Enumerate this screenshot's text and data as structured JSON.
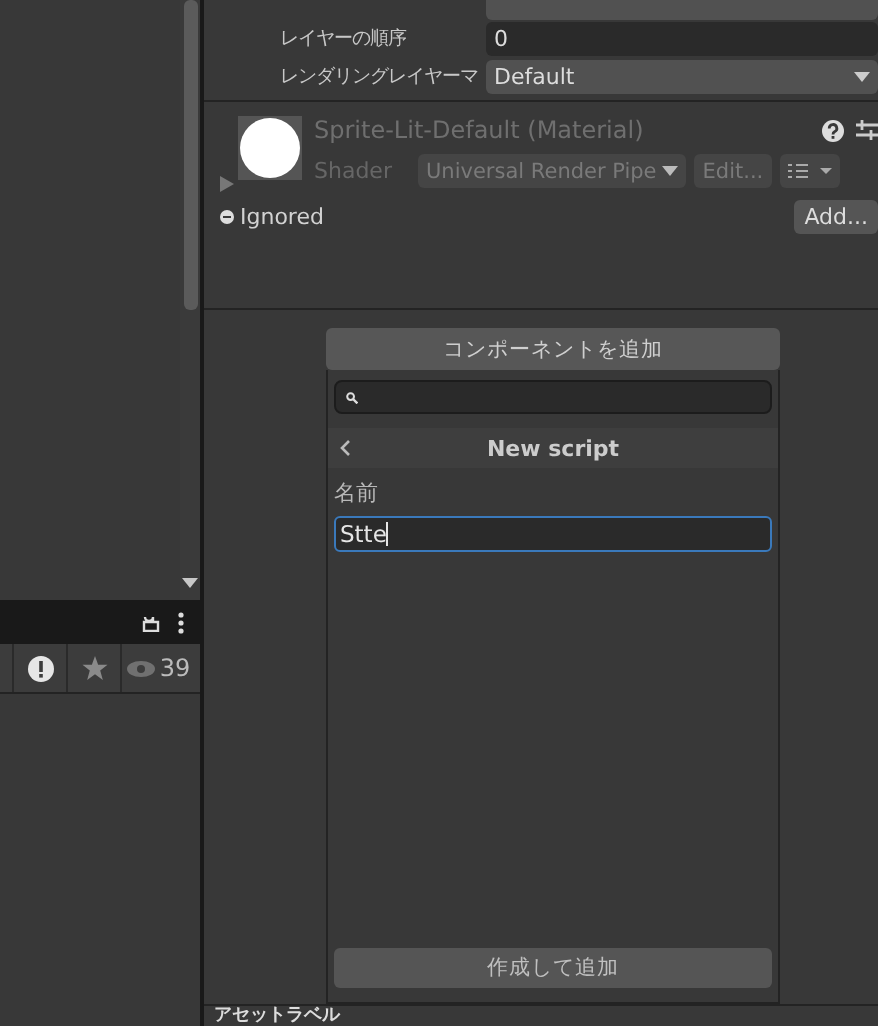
{
  "hierarchy_toolbar": {
    "count": "39"
  },
  "inspector": {
    "properties": [
      {
        "kind": "field",
        "label": "レイヤーの順序",
        "value": "0"
      },
      {
        "kind": "dropdown",
        "label": "レンダリングレイヤーマ",
        "value": "Default"
      }
    ],
    "material": {
      "name": "Sprite-Lit-Default (Material)",
      "shader_label": "Shader",
      "shader": "Universal Render Pipe",
      "edit_button": "Edit...",
      "expanded": false
    },
    "ignored": "Ignored",
    "add_button": "Add...",
    "add_component_button": "コンポーネントを追加",
    "popup": {
      "title": "New script",
      "name_label": "名前",
      "name_value": "Stte",
      "create_button": "作成して追加"
    },
    "section_label": "アセットラベル"
  }
}
